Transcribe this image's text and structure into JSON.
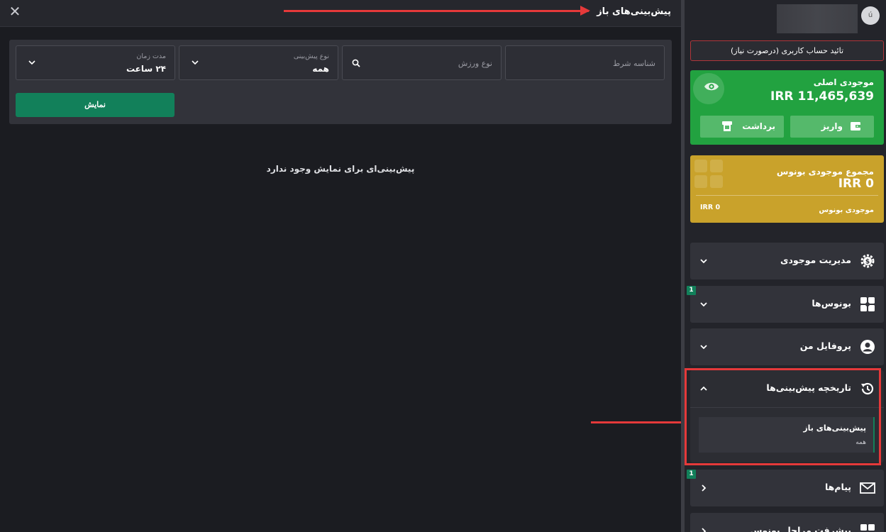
{
  "main": {
    "title": "پیش‌بینی‌های باز",
    "close_label": "✕",
    "filters": {
      "bet_id_placeholder": "شناسه شرط",
      "sport_type_placeholder": "نوع ورزش",
      "bet_type_label": "نوع پیش‌بینی",
      "bet_type_value": "همه",
      "duration_label": "مدت زمان",
      "duration_value": "۲۴ ساعت"
    },
    "show_button": "نمایش",
    "empty_message": "پیش‌بینی‌ای برای نمایش وجود ندارد"
  },
  "sidebar": {
    "avatar_initial": "ú",
    "verify_button": "تائید حساب کاربری (درصورت نیاز)",
    "main_balance": {
      "title": "موجودی اصلی",
      "amount": "IRR 11,465,639",
      "deposit_label": "واریز",
      "withdraw_label": "برداشت"
    },
    "bonus_balance": {
      "title": "مجموع موجودی بونوس",
      "amount": "IRR 0",
      "sub_label": "موجودی بونوس",
      "sub_value": "IRR 0"
    },
    "menu": [
      {
        "label": "مدیریت موجودی"
      },
      {
        "label": "بونوس‌ها",
        "badge": "1"
      },
      {
        "label": "پروفایل من"
      },
      {
        "label": "تاریخچه پیش‌بینی‌ها"
      },
      {
        "label": "پیام‌ها",
        "badge": "1"
      },
      {
        "label": "پیشرفت مراحل بونوس"
      }
    ],
    "history_sub": {
      "title": "پیش‌بینی‌های باز",
      "subtitle": "همه"
    }
  },
  "colors": {
    "accent_green": "#12805a",
    "balance_green": "#22a240",
    "bonus_gold": "#c9a22b",
    "annotation_red": "#e5393a"
  }
}
